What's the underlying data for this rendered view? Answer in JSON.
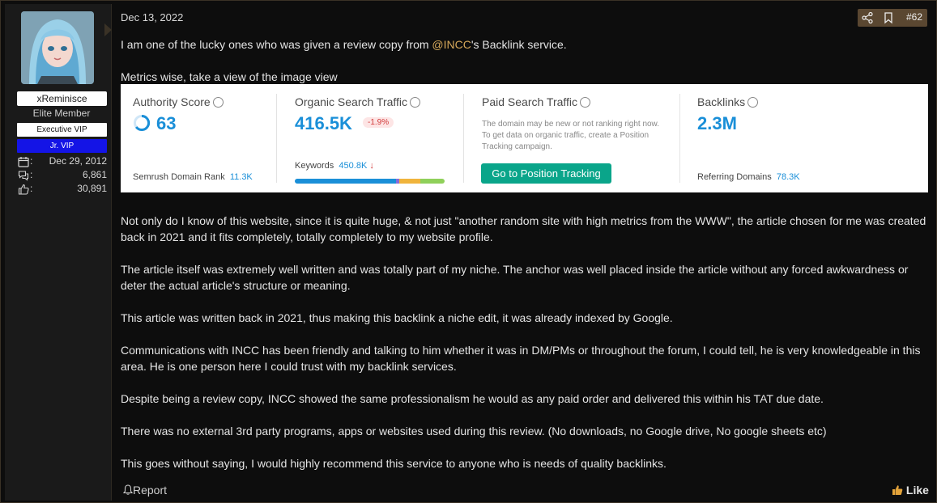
{
  "user": {
    "username": "xReminisce",
    "rank": "Elite Member",
    "badge_primary": "Executive VIP",
    "badge_secondary": "Jr. VIP",
    "stats": [
      {
        "icon": "calendar-icon",
        "value": "Dec 29, 2012"
      },
      {
        "icon": "messages-icon",
        "value": "6,861"
      },
      {
        "icon": "thumbs-up-icon",
        "value": "30,891"
      }
    ]
  },
  "post": {
    "date": "Dec 13, 2022",
    "number": "#62",
    "intro_before": "I am one of the lucky ones who was given a review copy from ",
    "intro_mention": "@INCC",
    "intro_after": "'s Backlink service.",
    "metrics_caption": "Metrics wise, take a view of the image view",
    "paragraphs": [
      "Not only do I know of this website, since it is quite huge, & not just \"another random site with high metrics from the WWW\", the article chosen for me was created back in 2021 and it fits completely, totally completely to my website profile.",
      "The article itself was extremely well written and was totally part of my niche. The anchor was well placed inside the article without any forced awkwardness or deter the actual article's structure or meaning.",
      "This article was written back in 2021, thus making this backlink a niche edit, it was already indexed by Google.",
      "Communications with INCC has been friendly and talking to him whether it was in DM/PMs or throughout the forum, I could tell, he is very knowledgeable in this area. He is one person here I could trust with my backlink services.",
      "Despite being a review copy, INCC showed the same professionalism he would as any paid order and delivered this within his TAT due date.",
      "There was no external 3rd party programs, apps or websites used during this review. (No downloads, no Google drive, No google sheets etc)",
      "This goes without saying, I would highly recommend this service to anyone who is needs of quality backlinks."
    ],
    "report_label": "Report",
    "like_label": "Like"
  },
  "metrics": {
    "authority": {
      "label": "Authority Score",
      "value": "63",
      "sub_label": "Semrush Domain Rank",
      "sub_value": "11.3K"
    },
    "organic": {
      "label": "Organic Search Traffic",
      "value": "416.5K",
      "change": "-1.9%",
      "sub_label": "Keywords",
      "sub_value": "450.8K",
      "sub_arrow": "↓"
    },
    "paid": {
      "label": "Paid Search Traffic",
      "desc": "The domain may be new or not ranking right now. To get data on organic traffic, create a Position Tracking campaign.",
      "button": "Go to Position Tracking"
    },
    "backlinks": {
      "label": "Backlinks",
      "value": "2.3M",
      "sub_label": "Referring Domains",
      "sub_value": "78.3K"
    },
    "colors": {
      "accent_blue": "#1a8fd8",
      "button_green": "#0aa58a",
      "negative_red": "#d23a3a"
    }
  }
}
